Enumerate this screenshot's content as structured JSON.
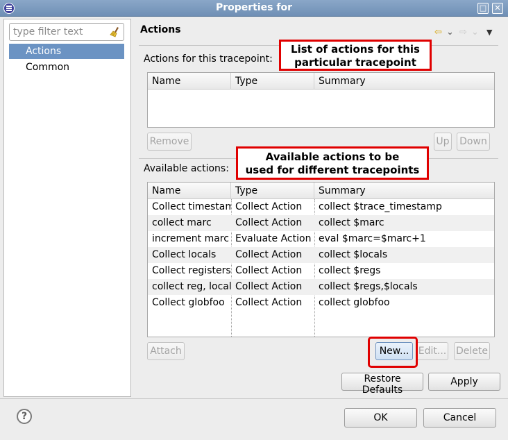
{
  "window": {
    "title": "Properties for",
    "maximize_glyph": "□",
    "close_glyph": "✕"
  },
  "sidebar": {
    "filter_placeholder": "type filter text",
    "items": [
      {
        "label": "Actions",
        "selected": true
      },
      {
        "label": "Common",
        "selected": false
      }
    ]
  },
  "page": {
    "title": "Actions",
    "nav": {
      "back_glyph": "⇦",
      "back_menu_glyph": "⌄",
      "forward_glyph": "⇨",
      "forward_menu_glyph": "⌄",
      "view_menu_glyph": "▼"
    }
  },
  "tracepoint_section": {
    "label": "Actions for this tracepoint:",
    "columns": [
      "Name",
      "Type",
      "Summary"
    ],
    "rows": [],
    "buttons": {
      "remove": "Remove",
      "up": "Up",
      "down": "Down"
    }
  },
  "available_section": {
    "label": "Available actions:",
    "columns": [
      "Name",
      "Type",
      "Summary"
    ],
    "rows": [
      {
        "name": "Collect timestamp",
        "type": "Collect Action",
        "summary": "collect $trace_timestamp"
      },
      {
        "name": "collect marc",
        "type": "Collect Action",
        "summary": "collect $marc"
      },
      {
        "name": "increment marc",
        "type": "Evaluate Action",
        "summary": "eval $marc=$marc+1"
      },
      {
        "name": "Collect locals",
        "type": "Collect Action",
        "summary": "collect $locals"
      },
      {
        "name": "Collect registers",
        "type": "Collect Action",
        "summary": "collect $regs"
      },
      {
        "name": "collect reg, locals",
        "type": "Collect Action",
        "summary": "collect $regs,$locals"
      },
      {
        "name": "Collect globfoo",
        "type": "Collect Action",
        "summary": "collect globfoo"
      }
    ],
    "buttons": {
      "attach": "Attach",
      "new": "New...",
      "edit": "Edit...",
      "delete": "Delete"
    }
  },
  "page_buttons": {
    "restore_defaults": "Restore Defaults",
    "apply": "Apply"
  },
  "dialog_buttons": {
    "ok": "OK",
    "cancel": "Cancel",
    "help_glyph": "?"
  },
  "annotations": {
    "tracepoint_callout": [
      "List of actions for this",
      "particular tracepoint"
    ],
    "available_callout": [
      "Available actions to be",
      "used for different tracepoints"
    ]
  },
  "colors": {
    "selection": "#6b93c3",
    "callout_red": "#e00000",
    "titlebar": "#7b99bd"
  }
}
